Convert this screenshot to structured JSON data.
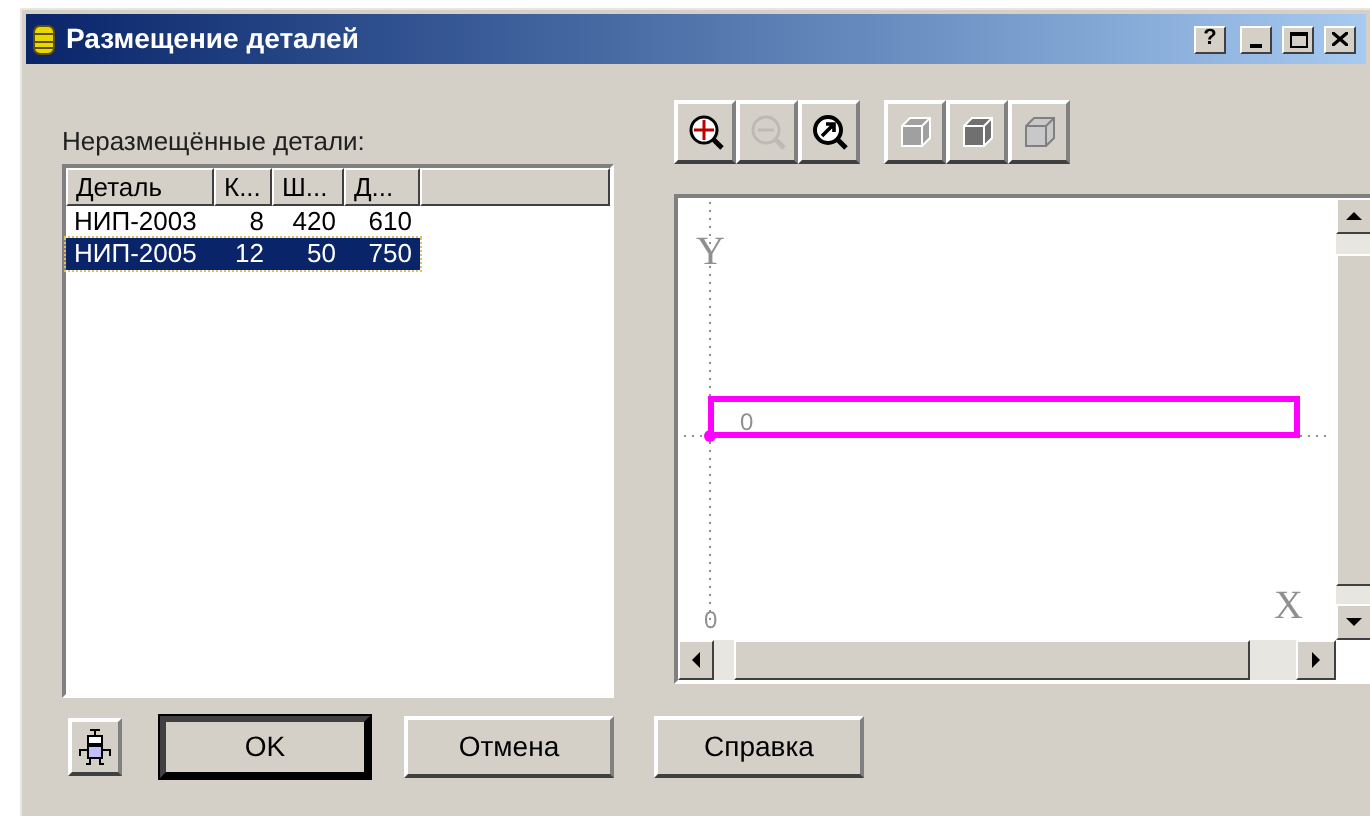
{
  "window": {
    "title": "Размещение деталей",
    "help_button": "?"
  },
  "parts_list": {
    "label": "Неразмещённые детали:",
    "columns": [
      "Деталь",
      "К...",
      "Ш...",
      "Д..."
    ],
    "rows": [
      {
        "cells": [
          "НИП-2003",
          "8",
          "420",
          "610"
        ],
        "selected": false
      },
      {
        "cells": [
          "НИП-2005",
          "12",
          "50",
          "750"
        ],
        "selected": true
      }
    ]
  },
  "toolbar": [
    {
      "kind": "zoom-in",
      "disabled": false
    },
    {
      "kind": "zoom-out",
      "disabled": true
    },
    {
      "kind": "zoom-fit",
      "disabled": false
    },
    {
      "kind": "cube-wire",
      "disabled": false
    },
    {
      "kind": "cube-solid",
      "disabled": false
    },
    {
      "kind": "cube-open",
      "disabled": false
    }
  ],
  "canvas": {
    "y_axis_label": "Y",
    "x_axis_label": "X",
    "origin_label": "0",
    "part": {
      "label": "0",
      "color": "#ff00ff"
    }
  },
  "buttons": [
    {
      "label": "OK",
      "default": true
    },
    {
      "label": "Отмена",
      "default": false
    },
    {
      "label": "Справка",
      "default": false
    }
  ]
}
